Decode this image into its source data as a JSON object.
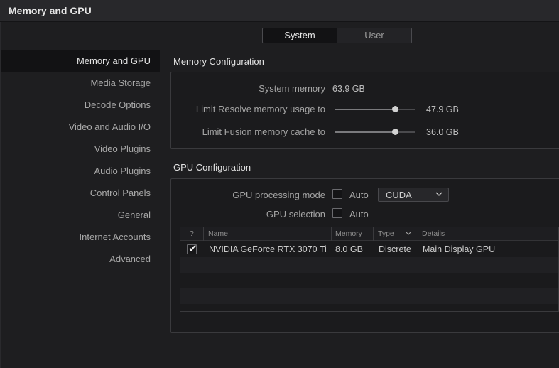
{
  "window": {
    "title": "Memory and GPU"
  },
  "tabs": [
    {
      "label": "System",
      "active": true
    },
    {
      "label": "User",
      "active": false
    }
  ],
  "sidebar": {
    "items": [
      {
        "label": "Memory and GPU",
        "active": true
      },
      {
        "label": "Media Storage"
      },
      {
        "label": "Decode Options"
      },
      {
        "label": "Video and Audio I/O"
      },
      {
        "label": "Video Plugins"
      },
      {
        "label": "Audio Plugins"
      },
      {
        "label": "Control Panels"
      },
      {
        "label": "General"
      },
      {
        "label": "Internet Accounts"
      },
      {
        "label": "Advanced"
      }
    ]
  },
  "memory": {
    "section_title": "Memory Configuration",
    "system_memory_label": "System memory",
    "system_memory_value": "63.9 GB",
    "resolve_label": "Limit Resolve memory usage to",
    "resolve_value": "47.9 GB",
    "resolve_fraction": 0.75,
    "fusion_label": "Limit Fusion memory cache to",
    "fusion_value": "36.0 GB",
    "fusion_fraction": 0.75
  },
  "gpu": {
    "section_title": "GPU Configuration",
    "mode_label": "GPU processing mode",
    "mode_auto_label": "Auto",
    "mode_auto_checked": false,
    "mode_selected": "CUDA",
    "selection_label": "GPU selection",
    "selection_auto_label": "Auto",
    "selection_auto_checked": false,
    "table": {
      "headers": {
        "check": "?",
        "name": "Name",
        "memory": "Memory",
        "type": "Type",
        "details": "Details"
      },
      "rows": [
        {
          "checked": true,
          "name": "NVIDIA GeForce RTX 3070 Ti",
          "memory": "8.0 GB",
          "type": "Discrete",
          "details": "Main Display GPU"
        }
      ]
    }
  },
  "colors": {
    "background": "#1e1e20",
    "panel": "#1b1b1d",
    "active_item": "#121214",
    "text": "#cfcfcf"
  }
}
